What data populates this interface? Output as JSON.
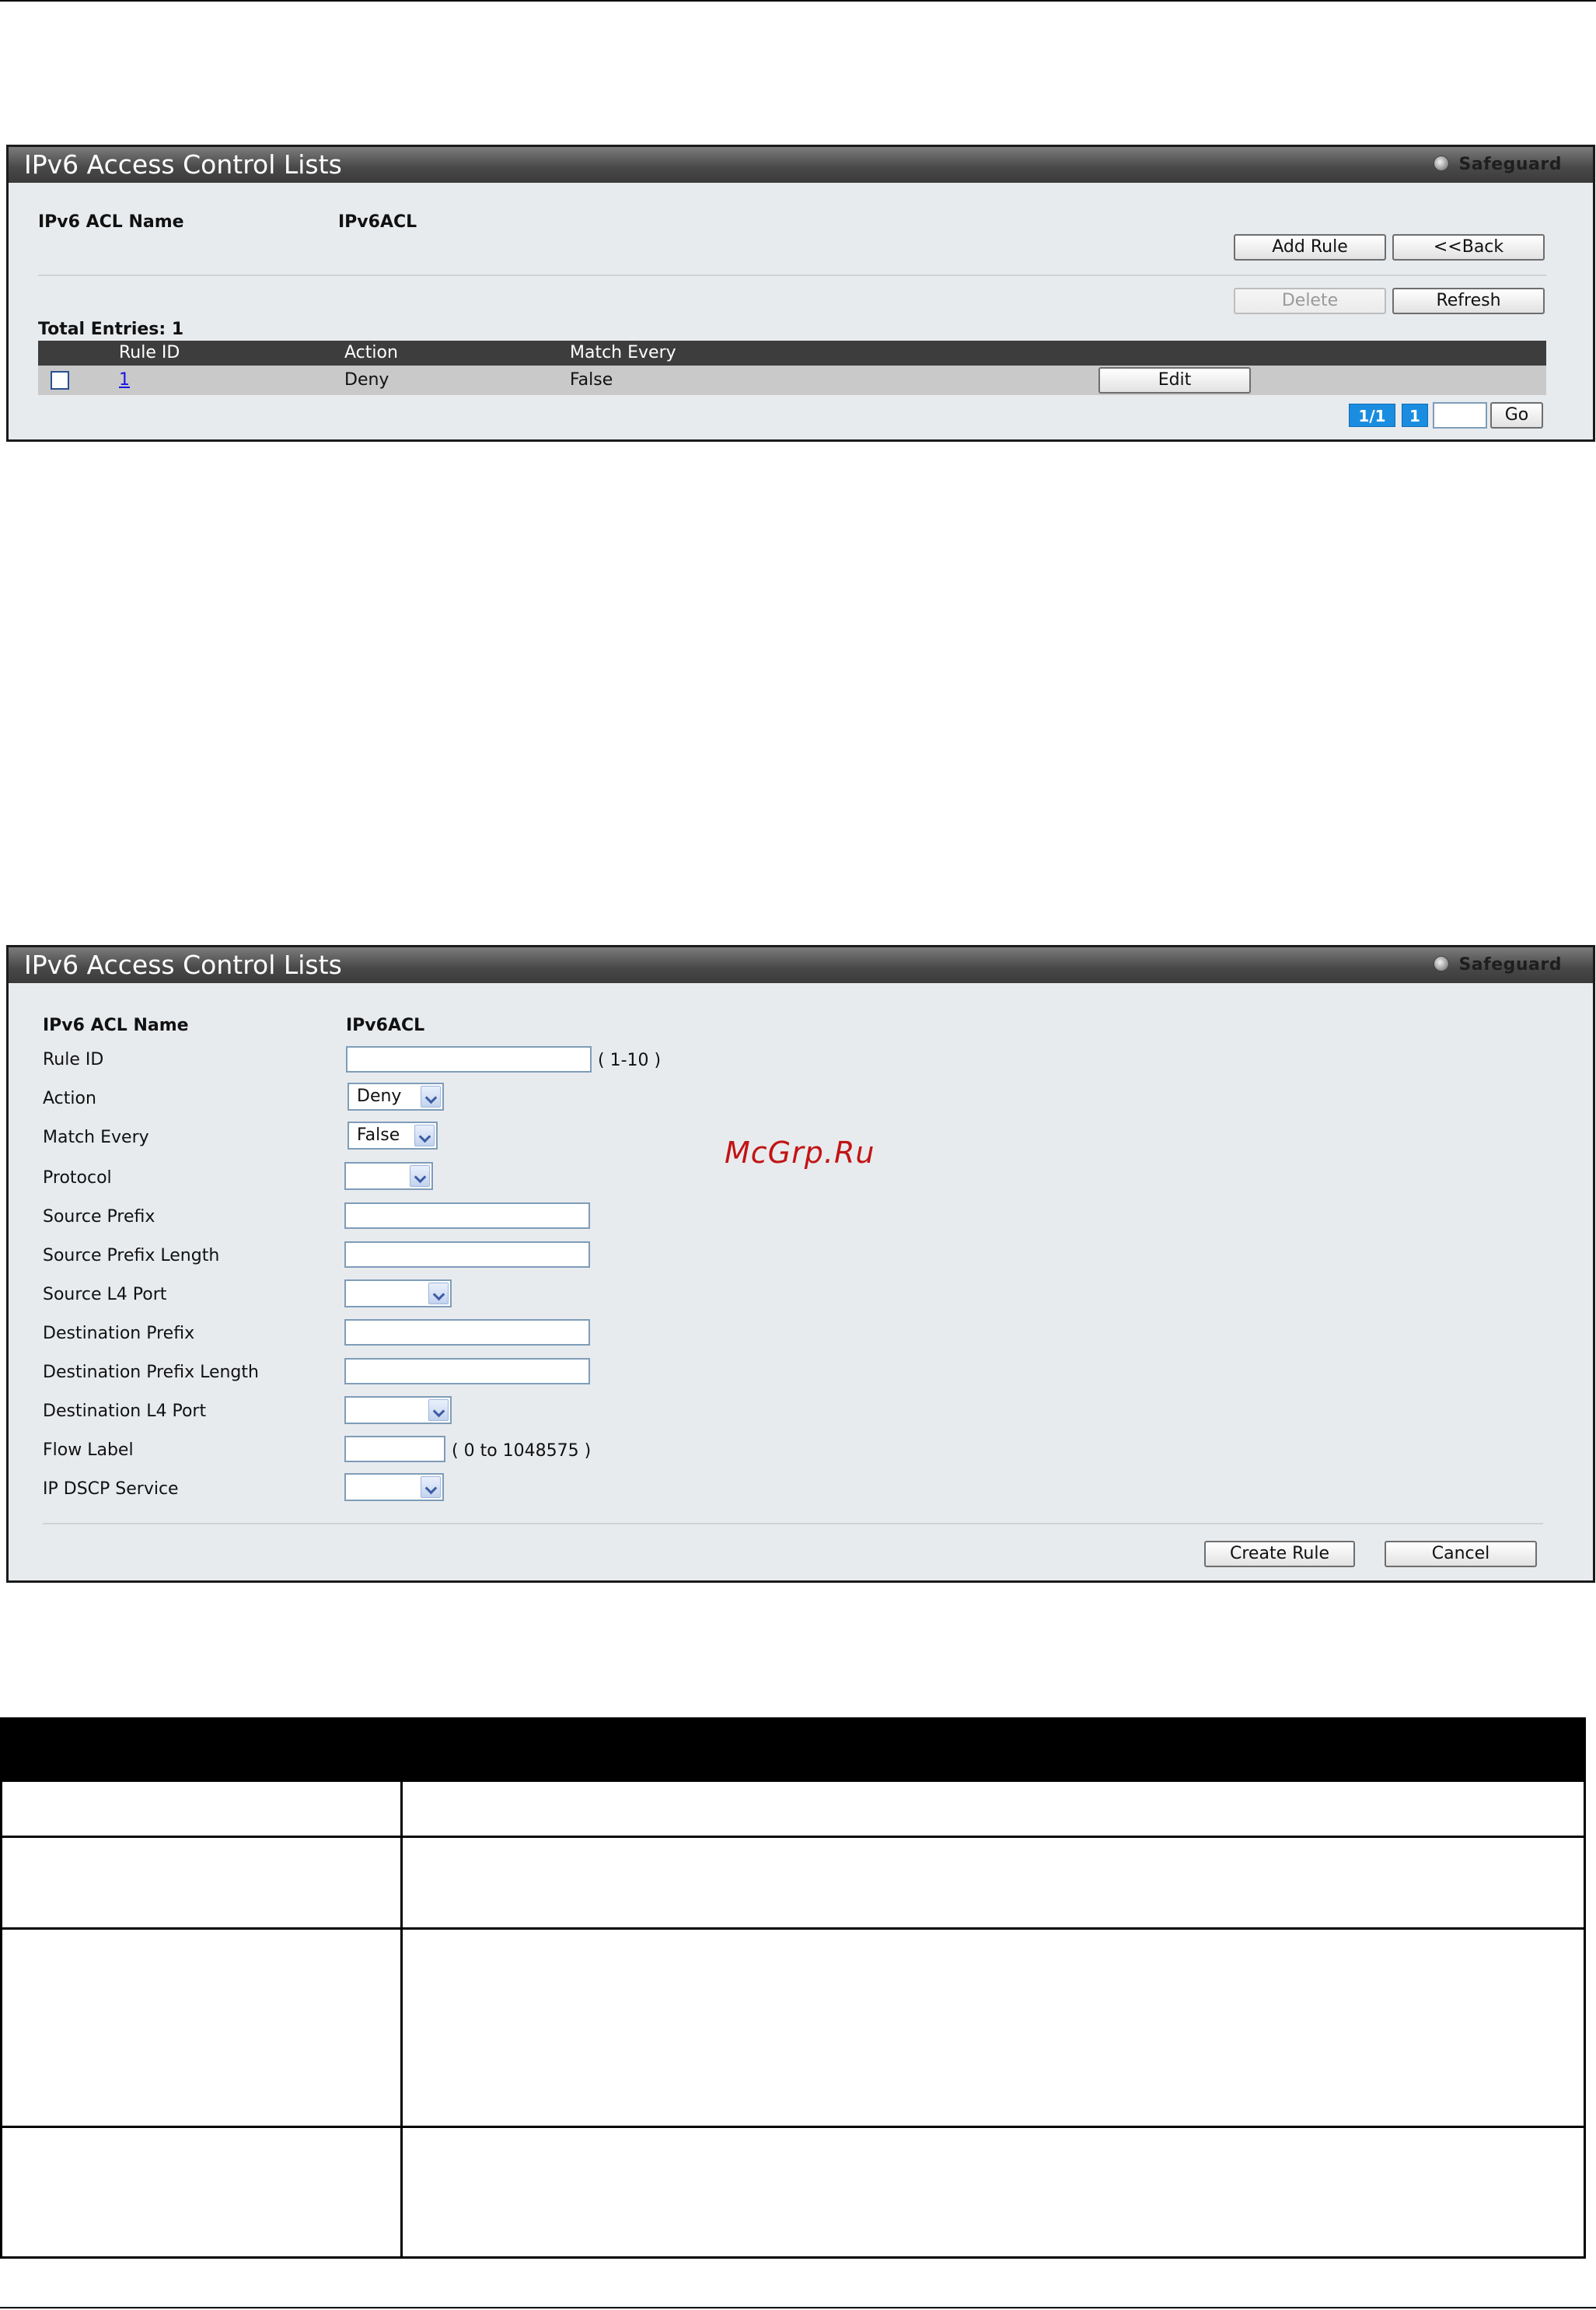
{
  "panel1": {
    "title": "IPv6 Access Control Lists",
    "safeguard": "Safeguard",
    "acl_name_label": "IPv6 ACL Name",
    "acl_name_value": "IPv6ACL",
    "buttons": {
      "add_rule": "Add Rule",
      "back": "<<Back",
      "delete": "Delete",
      "refresh": "Refresh",
      "go": "Go"
    },
    "total_entries": "Total Entries: 1",
    "columns": [
      "Rule ID",
      "Action",
      "Match Every"
    ],
    "rows": [
      {
        "rule_id": "1",
        "action": "Deny",
        "match_every": "False",
        "edit": "Edit"
      }
    ],
    "pagination": {
      "pages": "1/1",
      "current": "1"
    }
  },
  "panel2": {
    "title": "IPv6 Access Control Lists",
    "safeguard": "Safeguard",
    "acl_name_label": "IPv6 ACL Name",
    "acl_name_value": "IPv6ACL",
    "fields": {
      "rule_id": {
        "label": "Rule ID",
        "hint": "( 1-10 )"
      },
      "action": {
        "label": "Action",
        "value": "Deny"
      },
      "match_every": {
        "label": "Match Every",
        "value": "False"
      },
      "protocol": {
        "label": "Protocol",
        "value": ""
      },
      "source_prefix": {
        "label": "Source Prefix"
      },
      "source_prefix_length": {
        "label": "Source Prefix Length"
      },
      "source_l4_port": {
        "label": "Source L4 Port",
        "value": ""
      },
      "destination_prefix": {
        "label": "Destination Prefix"
      },
      "destination_prefix_length": {
        "label": "Destination Prefix Length"
      },
      "destination_l4_port": {
        "label": "Destination L4 Port",
        "value": ""
      },
      "flow_label": {
        "label": "Flow Label",
        "hint": "( 0 to 1048575 )"
      },
      "ip_dscp_service": {
        "label": "IP DSCP Service",
        "value": ""
      }
    },
    "buttons": {
      "create_rule": "Create Rule",
      "cancel": "Cancel"
    }
  },
  "watermark": "McGrp.Ru"
}
